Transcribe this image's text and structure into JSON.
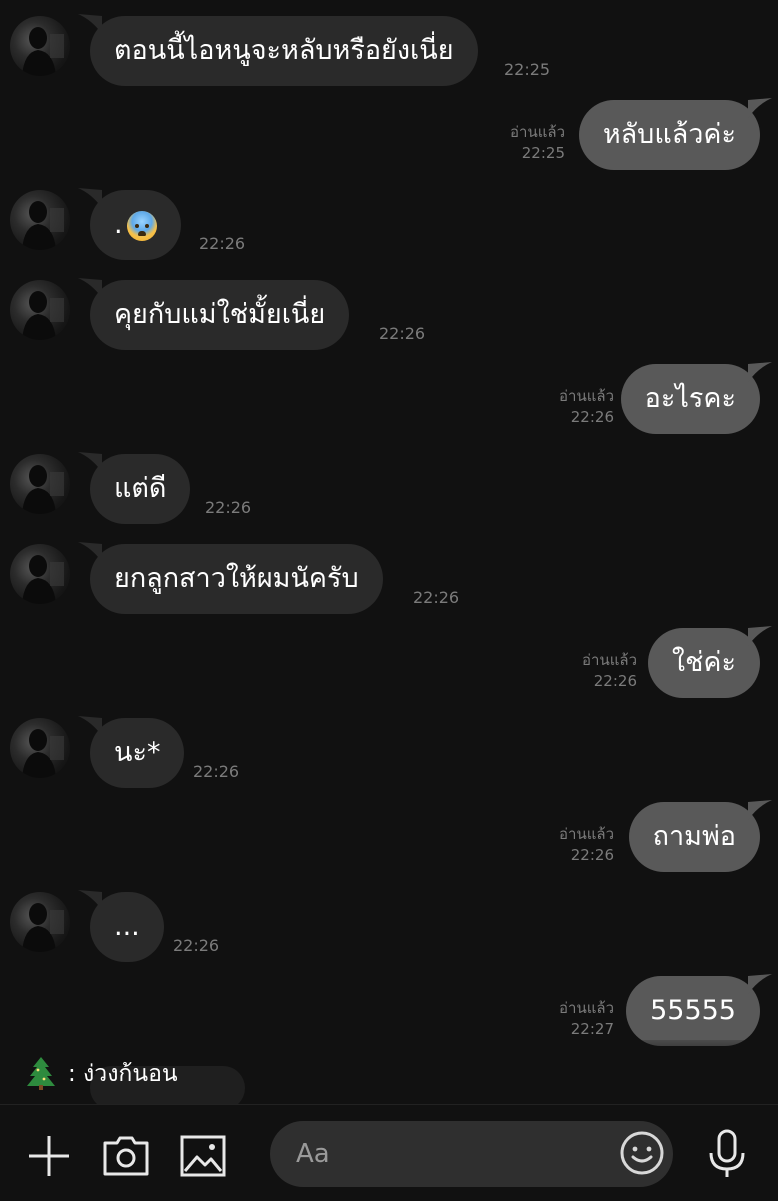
{
  "messages": [
    {
      "side": "in",
      "text": "ตอนนี้ไอหนูจะหลับหรือยังเนี่ย",
      "time": "22:25"
    },
    {
      "side": "out",
      "text": "หลับแล้วค่ะ",
      "read": "อ่านแล้ว",
      "time": "22:25"
    },
    {
      "side": "in",
      "text": ".",
      "emoji": "anxious-sweat-face-emoji",
      "time": "22:26"
    },
    {
      "side": "in",
      "text": "คุยกับแม่ใช่มั้ยเนี่ย",
      "time": "22:26"
    },
    {
      "side": "out",
      "text": "อะไรคะ",
      "read": "อ่านแล้ว",
      "time": "22:26"
    },
    {
      "side": "in",
      "text": "แต่ดี",
      "time": "22:26"
    },
    {
      "side": "in",
      "text": "ยกลูกสาวให้ผมนัครับ",
      "time": "22:26"
    },
    {
      "side": "out",
      "text": "ใช่ค่ะ",
      "read": "อ่านแล้ว",
      "time": "22:26"
    },
    {
      "side": "in",
      "text": "นะ*",
      "time": "22:26"
    },
    {
      "side": "out",
      "text": "ถามพ่อ",
      "read": "อ่านแล้ว",
      "time": "22:26"
    },
    {
      "side": "in",
      "text": "...",
      "time": "22:26"
    },
    {
      "side": "out",
      "text": "55555",
      "read": "อ่านแล้ว",
      "time": "22:27"
    }
  ],
  "notification": {
    "icon": "christmas-tree-icon",
    "label": ": ง่วงก้นอน"
  },
  "toolbar": {
    "icons": [
      "plus-icon",
      "camera-icon",
      "image-icon",
      "emoji-icon",
      "mic-icon"
    ],
    "input_placeholder": "Aa"
  },
  "colors": {
    "background": "#111111",
    "incoming_bubble": "#2a2a2a",
    "outgoing_bubble": "#595959",
    "muted_text": "#7b7b7b"
  }
}
